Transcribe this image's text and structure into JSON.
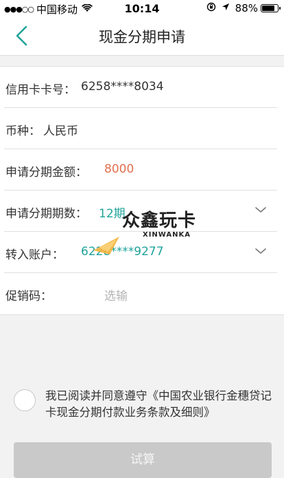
{
  "status": {
    "signal": "●●●○○",
    "carrier": "中国移动",
    "wifi_icon": "wifi-icon",
    "time": "10:14",
    "orientation_lock_icon": "orientation-lock-icon",
    "location_icon": "location-arrow-icon",
    "battery_text": "88%",
    "battery_level": 0.88
  },
  "nav": {
    "back_icon": "chevron-left-icon",
    "title": "现金分期申请"
  },
  "form": {
    "card_label": "信用卡卡号：",
    "card_value": "6258****8034",
    "currency_label": "币种：",
    "currency_value": "人民币",
    "amount_label": "申请分期金额：",
    "amount_value": "8000",
    "period_label": "申请分期期数：",
    "period_value": "12期",
    "account_label": "转入账户：",
    "account_value": "6228****9277",
    "promo_label": "促销码：",
    "promo_placeholder": "选输"
  },
  "watermark": {
    "text": "众鑫玩卡",
    "sub": "XINWANKA"
  },
  "agreement": {
    "text": "我已阅读并同意遵守《中国农业银行金穗贷记卡现金分期付款业务条款及细则》"
  },
  "actions": {
    "trial_label": "试算"
  },
  "colors": {
    "accent": "#1fa39a",
    "amount": "#e0704f",
    "placeholder": "#b3b3b3",
    "button_disabled": "#c9c9c9"
  }
}
